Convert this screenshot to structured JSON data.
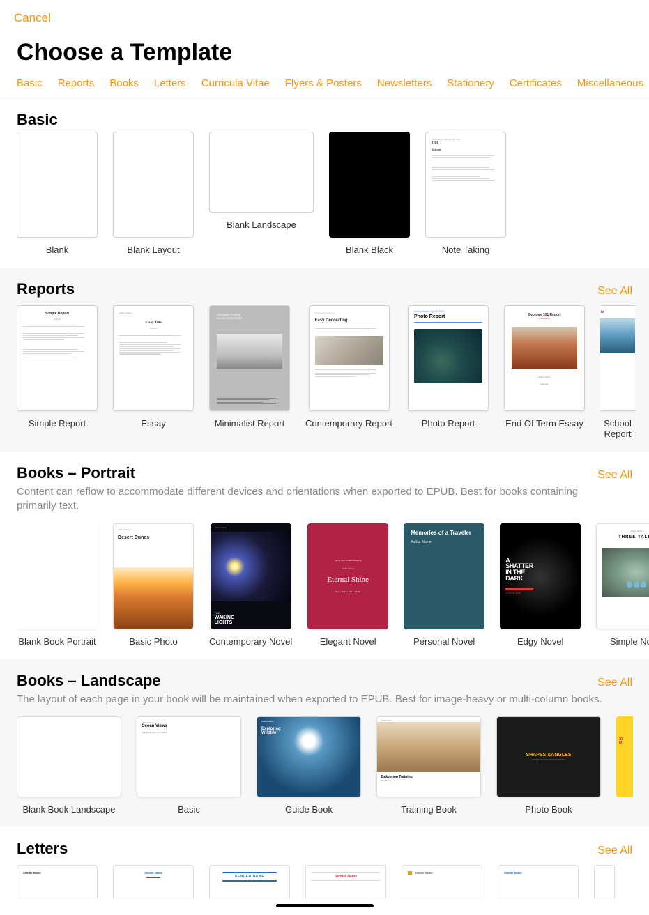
{
  "header": {
    "cancel": "Cancel",
    "title": "Choose a Template"
  },
  "categories": [
    "Basic",
    "Reports",
    "Books",
    "Letters",
    "Curricula Vitae",
    "Flyers & Posters",
    "Newsletters",
    "Stationery",
    "Certificates",
    "Miscellaneous"
  ],
  "see_all": "See All",
  "sections": {
    "basic": {
      "title": "Basic",
      "items": [
        {
          "label": "Blank"
        },
        {
          "label": "Blank Layout"
        },
        {
          "label": "Blank Landscape"
        },
        {
          "label": "Blank Black"
        },
        {
          "label": "Note Taking"
        }
      ]
    },
    "reports": {
      "title": "Reports",
      "items": [
        {
          "label": "Simple Report"
        },
        {
          "label": "Essay"
        },
        {
          "label": "Minimalist Report"
        },
        {
          "label": "Contemporary Report"
        },
        {
          "label": "Photo Report"
        },
        {
          "label": "End Of Term Essay"
        },
        {
          "label": "School Report"
        }
      ]
    },
    "books_portrait": {
      "title": "Books – Portrait",
      "desc": "Content can reflow to accommodate different devices and orientations when exported to EPUB. Best for books containing primarily text.",
      "items": [
        {
          "label": "Blank Book Portrait"
        },
        {
          "label": "Basic Photo"
        },
        {
          "label": "Contemporary Novel"
        },
        {
          "label": "Elegant Novel"
        },
        {
          "label": "Personal Novel"
        },
        {
          "label": "Edgy Novel"
        },
        {
          "label": "Simple Novel"
        }
      ]
    },
    "books_landscape": {
      "title": "Books – Landscape",
      "desc": "The layout of each page in your book will be maintained when exported to EPUB. Best for image-heavy or multi-column books.",
      "items": [
        {
          "label": "Blank Book Landscape"
        },
        {
          "label": "Basic"
        },
        {
          "label": "Guide Book"
        },
        {
          "label": "Training Book"
        },
        {
          "label": "Photo Book"
        }
      ]
    },
    "letters": {
      "title": "Letters"
    }
  },
  "thumb_text": {
    "note_date": "Wednesday, February 19, 2014",
    "note_title": "Title",
    "note_heading": "School",
    "simple_report": "Simple Report",
    "essay_title": "Essay Title",
    "essay_sub": "Subtitle",
    "essay_author": "Author Name",
    "minr_l1": "ORGANIC FORMS",
    "minr_l2": "IN ARCHITECTURE",
    "conr_small": "Simple Home Styling",
    "conr_title": "Easy Decorating",
    "phor_top": "Author Name • April 8, 2020",
    "phor_title": "Photo Report",
    "eot_title": "Geology 101 Report",
    "eot_sub": "Subheading",
    "eot_auth": "Author Name",
    "eot_date": "February",
    "school_t": "A Voyage to",
    "bp_auth": "Author Name",
    "bp_title": "Desert Dunes",
    "wak_cyan": "THE",
    "wak_t1": "WAKING",
    "wak_t2": "LIGHTS",
    "eleg_top": "Tap or click to add a heading",
    "eleg_auth": "Author Name",
    "eleg_t": "Eternal Shine",
    "eleg_bot": "Tap or click to add a subtitle",
    "pers_t": "Memories of a Traveler",
    "pers_a": "Author Name",
    "edgy_t1": "A",
    "edgy_t2": "SHATTER",
    "edgy_t3": "IN THE",
    "edgy_t4": "DARK",
    "edgy_auth": "AUTHOR NAME",
    "simp_small": "Author Name",
    "simp_t": "THREE TALES",
    "bl_auth": "Author Name",
    "bl_t": "Ocean Views",
    "bl_sub": "Highlights From My Travels",
    "gd_auth": "Author Name",
    "gd_t1": "Exploring",
    "gd_t2": "Wildlife",
    "tr_ed": "2020 Edition",
    "tr_t": "Bakeshop Training",
    "tr_sub": "The Basics",
    "pb_t": "SHAPES &ANGLES",
    "pb_sub": "ARCHITECTURAL PHOTOGRAPHY",
    "ltr_sender": "Sender Name",
    "ltr_sender_caps": "SENDER NAME"
  }
}
